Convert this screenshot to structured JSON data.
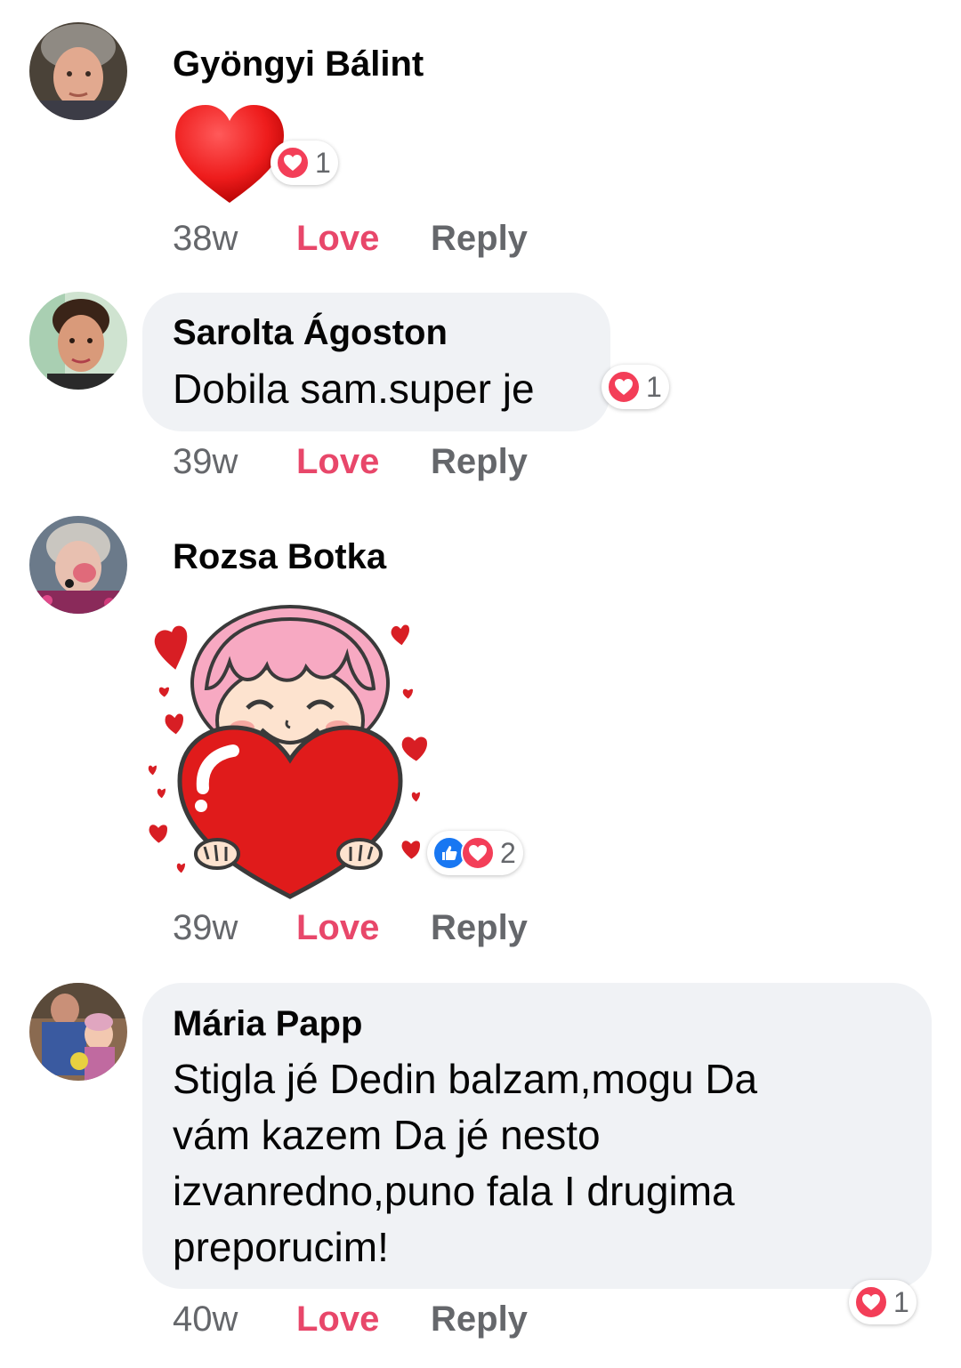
{
  "comments": [
    {
      "author": "Gyöngyi Bálint",
      "time": "38w",
      "love_label": "Love",
      "reply_label": "Reply",
      "reaction_count": "1",
      "attachment": "heart-emoji"
    },
    {
      "author": "Sarolta Ágoston",
      "text": "Dobila sam.super je",
      "time": "39w",
      "love_label": "Love",
      "reply_label": "Reply",
      "reaction_count": "1"
    },
    {
      "author": "Rozsa Botka",
      "time": "39w",
      "love_label": "Love",
      "reply_label": "Reply",
      "reaction_count": "2",
      "attachment": "girl-holding-heart-sticker"
    },
    {
      "author": "Mária Papp",
      "text_lines": [
        "Stigla jé Dedin balzam,mogu Da",
        "vám kazem Da jé nesto",
        "izvanredno,puno fala I drugima",
        "preporucim!"
      ],
      "time": "40w",
      "love_label": "Love",
      "reply_label": "Reply",
      "reaction_count": "1"
    }
  ],
  "colors": {
    "love_accent": "#e8476a",
    "bubble_bg": "#f0f2f5",
    "meta_gray": "#65676b",
    "heart_reaction": "#f33e58",
    "like_reaction": "#1877f2"
  }
}
